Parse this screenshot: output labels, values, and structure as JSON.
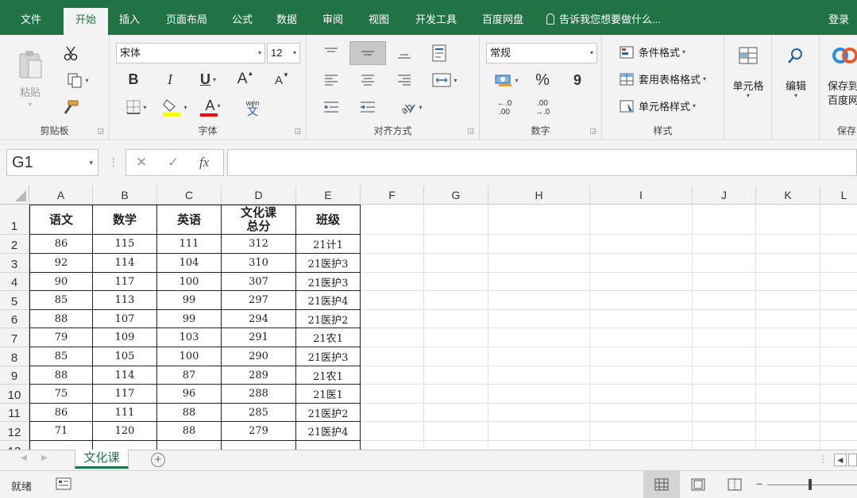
{
  "menu": {
    "tabs": [
      "文件",
      "开始",
      "插入",
      "页面布局",
      "公式",
      "数据",
      "审阅",
      "视图",
      "开发工具",
      "百度网盘"
    ],
    "active_index": 1,
    "tell_me": "告诉我您想要做什么...",
    "login": "登录"
  },
  "ribbon": {
    "clipboard": {
      "paste": "粘贴",
      "label": "剪贴板"
    },
    "font": {
      "name": "宋体",
      "size": "12",
      "bold": "B",
      "italic": "I",
      "underline": "U",
      "grow": "A",
      "shrink": "A",
      "font_color_letter": "A",
      "phonetic_top": "wén",
      "phonetic_bottom": "文",
      "label": "字体",
      "fill_color": "#ffff00",
      "font_color": "#ff0000"
    },
    "alignment": {
      "label": "对齐方式"
    },
    "number": {
      "format": "常规",
      "percent": "%",
      "comma": "9",
      "inc_decimal_top": "←.0",
      "inc_decimal_bottom": ".00",
      "dec_decimal_top": ".00",
      "dec_decimal_bottom": "→.0",
      "label": "数字"
    },
    "styles": {
      "conditional": "条件格式",
      "table": "套用表格格式",
      "cell_styles": "单元格样式",
      "label": "样式"
    },
    "cells": {
      "label": "单元格"
    },
    "editing": {
      "label": "编辑"
    },
    "baidu": {
      "line1": "保存到",
      "line2": "百度网",
      "label": "保存"
    }
  },
  "formula_bar": {
    "name_box": "G1",
    "cancel": "✕",
    "enter": "✓",
    "fx": "fx",
    "content": ""
  },
  "grid": {
    "columns": [
      "A",
      "B",
      "C",
      "D",
      "E",
      "F",
      "G",
      "H",
      "I",
      "J",
      "K",
      "L"
    ],
    "rows": [
      "1",
      "2",
      "3",
      "4",
      "5",
      "6",
      "7",
      "8",
      "9",
      "10",
      "11",
      "12",
      "13"
    ],
    "header": [
      "语文",
      "数学",
      "英语",
      "文化课\n总分",
      "班级"
    ],
    "data": [
      [
        "86",
        "115",
        "111",
        "312",
        "21计1"
      ],
      [
        "92",
        "114",
        "104",
        "310",
        "21医护3"
      ],
      [
        "90",
        "117",
        "100",
        "307",
        "21医护3"
      ],
      [
        "85",
        "113",
        "99",
        "297",
        "21医护4"
      ],
      [
        "88",
        "107",
        "99",
        "294",
        "21医护2"
      ],
      [
        "79",
        "109",
        "103",
        "291",
        "21农1"
      ],
      [
        "85",
        "105",
        "100",
        "290",
        "21医护3"
      ],
      [
        "88",
        "114",
        "87",
        "289",
        "21农1"
      ],
      [
        "75",
        "117",
        "96",
        "288",
        "21医1"
      ],
      [
        "86",
        "111",
        "88",
        "285",
        "21医护2"
      ],
      [
        "71",
        "120",
        "88",
        "279",
        "21医护4"
      ],
      [
        "",
        "",
        "",
        "",
        ""
      ]
    ]
  },
  "sheets": {
    "tabs": [
      "文化课"
    ],
    "add": "+"
  },
  "status": {
    "ready": "就绪"
  }
}
